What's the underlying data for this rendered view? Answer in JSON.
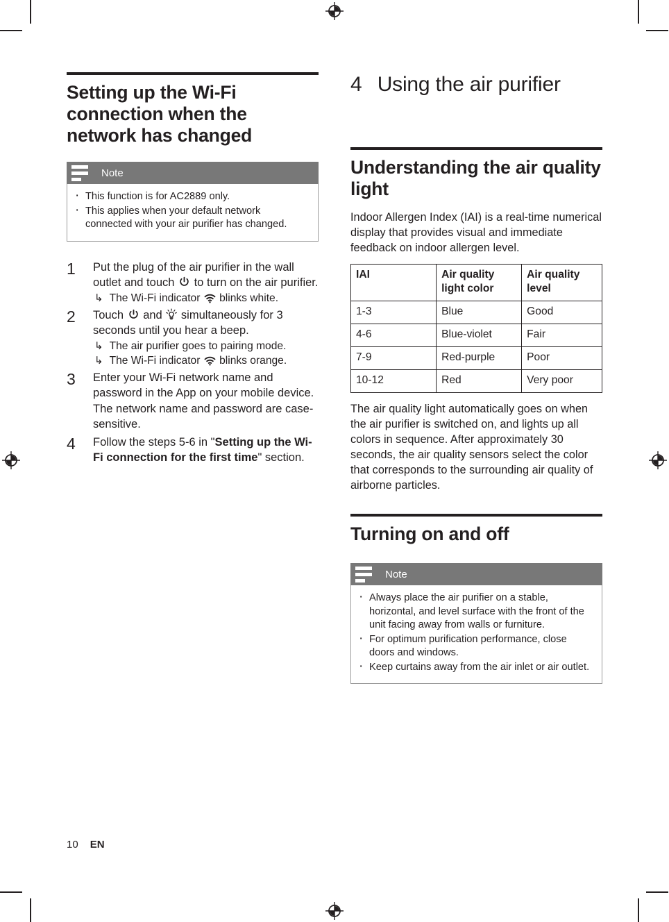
{
  "page": {
    "number": "10",
    "language": "EN"
  },
  "left_column": {
    "section_title": "Setting up the Wi-Fi connection when the network has changed",
    "note": {
      "label": "Note",
      "icon": "note-lines-icon",
      "items": [
        "This function is for AC2889 only.",
        "This applies when your default network connected with your air purifier has changed."
      ]
    },
    "steps": [
      {
        "number": "1",
        "text_before": "Put the plug of the air purifier in the wall outlet and touch ",
        "icon": "power-icon",
        "text_after": " to turn on the air purifier.",
        "results": [
          {
            "text_before": "The Wi-Fi indicator ",
            "icon": "wifi-icon",
            "text_after": " blinks white."
          }
        ]
      },
      {
        "number": "2",
        "text_before": "Touch ",
        "icon": "power-icon",
        "text_middle": " and ",
        "icon2": "light-bulb-icon",
        "text_after": " simultaneously for 3 seconds until you hear a beep.",
        "results": [
          {
            "text_before": "The air purifier goes to pairing mode.",
            "icon": "",
            "text_after": ""
          },
          {
            "text_before": "The Wi-Fi indicator ",
            "icon": "wifi-icon",
            "text_after": " blinks orange."
          }
        ]
      },
      {
        "number": "3",
        "text_before": "Enter your Wi-Fi network name and password in the App on your mobile device. The network name and password are case-sensitive.",
        "results": []
      },
      {
        "number": "4",
        "text_before": "Follow the steps 5-6 in \"",
        "bold": "Setting up the Wi-Fi connection for the first time",
        "text_after": "\" section.",
        "results": []
      }
    ]
  },
  "right_column": {
    "chapter": {
      "number": "4",
      "title": "Using the air purifier"
    },
    "section1": {
      "title": "Understanding the air quality light",
      "intro": "Indoor Allergen Index (IAI) is a real-time numerical display that provides visual and immediate feedback on indoor allergen level.",
      "table": {
        "headers": [
          "IAI",
          "Air quality light color",
          "Air quality level"
        ],
        "rows": [
          [
            "1-3",
            "Blue",
            "Good"
          ],
          [
            "4-6",
            "Blue-violet",
            "Fair"
          ],
          [
            "7-9",
            "Red-purple",
            "Poor"
          ],
          [
            "10-12",
            "Red",
            "Very poor"
          ]
        ]
      },
      "after_table": "The air quality light automatically goes on when the air purifier is switched on, and lights up all colors in sequence. After approximately 30 seconds, the air quality sensors select the color that corresponds to the surrounding air quality of airborne particles."
    },
    "section2": {
      "title": "Turning on and off",
      "note": {
        "label": "Note",
        "icon": "note-lines-icon",
        "items": [
          "Always place the air purifier on a stable, horizontal, and level surface with the front of the unit facing away from walls or furniture.",
          "For optimum purification performance, close doors and windows.",
          "Keep curtains away from the air inlet or air outlet."
        ]
      }
    }
  },
  "print_marks": {
    "registration_icon": "registration-target-icon",
    "crop_icon": "crop-mark-icon"
  }
}
